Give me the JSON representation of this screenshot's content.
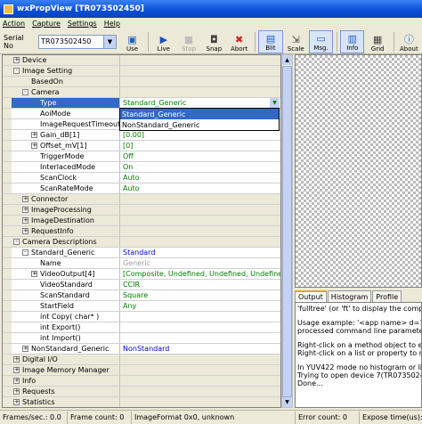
{
  "window": {
    "title": "wxPropView [TR073502450]"
  },
  "menu": [
    "Action",
    "Capture",
    "Settings",
    "Help"
  ],
  "toolbar": {
    "serial_label": "Serial No",
    "serial_value": "TR073502450",
    "buttons": [
      {
        "label": "Use",
        "icon": "use-icon"
      },
      {
        "label": "Live",
        "icon": "play-icon"
      },
      {
        "label": "Stop",
        "icon": "stop-icon",
        "disabled": true
      },
      {
        "label": "Snap",
        "icon": "camera-icon"
      },
      {
        "label": "Abort",
        "icon": "abort-icon"
      },
      {
        "label": "Blit",
        "icon": "blit-icon",
        "selected": true
      },
      {
        "label": "Scale",
        "icon": "scale-icon"
      },
      {
        "label": "Msg.",
        "icon": "message-icon",
        "selected": true
      },
      {
        "label": "Info",
        "icon": "info-icon",
        "selected": true
      },
      {
        "label": "Grid",
        "icon": "grid-icon"
      },
      {
        "label": "About",
        "icon": "about-icon"
      }
    ]
  },
  "properties": [
    {
      "level": 0,
      "exp": "+",
      "name": "Device",
      "value": "",
      "cat": true
    },
    {
      "level": 0,
      "exp": "-",
      "name": "Image Setting",
      "value": "",
      "cat": true
    },
    {
      "level": 1,
      "exp": "",
      "name": "BasedOn",
      "value": "",
      "cat": true
    },
    {
      "level": 1,
      "exp": "-",
      "name": "Camera",
      "value": "",
      "cat": true
    },
    {
      "level": 2,
      "exp": "",
      "name": "Type",
      "value": "Standard_Generic",
      "combo": true,
      "sel": true
    },
    {
      "level": 2,
      "exp": "",
      "name": "AoiMode",
      "value": ""
    },
    {
      "level": 2,
      "exp": "",
      "name": "ImageRequestTimeout_ms",
      "value": ""
    },
    {
      "level": 2,
      "exp": "+",
      "name": "Gain_dB[1]",
      "value": "[0.00]"
    },
    {
      "level": 2,
      "exp": "+",
      "name": "Offset_mV[1]",
      "value": "[0]"
    },
    {
      "level": 2,
      "exp": "",
      "name": "TriggerMode",
      "value": "Off"
    },
    {
      "level": 2,
      "exp": "",
      "name": "InterlacedMode",
      "value": "On"
    },
    {
      "level": 2,
      "exp": "",
      "name": "ScanClock",
      "value": "Auto"
    },
    {
      "level": 2,
      "exp": "",
      "name": "ScanRateMode",
      "value": "Auto"
    },
    {
      "level": 1,
      "exp": "+",
      "name": "Connector",
      "value": "",
      "cat": true
    },
    {
      "level": 1,
      "exp": "+",
      "name": "ImageProcessing",
      "value": "",
      "cat": true
    },
    {
      "level": 1,
      "exp": "+",
      "name": "ImageDestination",
      "value": "",
      "cat": true
    },
    {
      "level": 1,
      "exp": "+",
      "name": "RequestInfo",
      "value": "",
      "cat": true
    },
    {
      "level": 0,
      "exp": "-",
      "name": "Camera Descriptions",
      "value": "",
      "cat": true
    },
    {
      "level": 1,
      "exp": "-",
      "name": "Standard_Generic",
      "value": "Standard",
      "vcolor": "blue"
    },
    {
      "level": 2,
      "exp": "",
      "name": "Name",
      "value": "Generic",
      "vcolor": "gray"
    },
    {
      "level": 2,
      "exp": "+",
      "name": "VideoOutput[4]",
      "value": "[Composite, Undefined, Undefined, Undefined]"
    },
    {
      "level": 2,
      "exp": "",
      "name": "VideoStandard",
      "value": "CCIR"
    },
    {
      "level": 2,
      "exp": "",
      "name": "ScanStandard",
      "value": "Square"
    },
    {
      "level": 2,
      "exp": "",
      "name": "StartField",
      "value": "Any"
    },
    {
      "level": 2,
      "exp": "",
      "name": "int Copy( char* )",
      "value": ""
    },
    {
      "level": 2,
      "exp": "",
      "name": "int Export()",
      "value": ""
    },
    {
      "level": 2,
      "exp": "",
      "name": "int Import()",
      "value": ""
    },
    {
      "level": 1,
      "exp": "+",
      "name": "NonStandard_Generic",
      "value": "NonStandard",
      "vcolor": "blue"
    },
    {
      "level": 0,
      "exp": "+",
      "name": "Digital I/O",
      "value": "",
      "cat": true
    },
    {
      "level": 0,
      "exp": "+",
      "name": "Image Memory Manager",
      "value": "",
      "cat": true
    },
    {
      "level": 0,
      "exp": "+",
      "name": "Info",
      "value": "",
      "cat": true
    },
    {
      "level": 0,
      "exp": "+",
      "name": "Requests",
      "value": "",
      "cat": true
    },
    {
      "level": 0,
      "exp": "+",
      "name": "Statistics",
      "value": "",
      "cat": true
    },
    {
      "level": 0,
      "exp": "+",
      "name": "System Settings",
      "value": "",
      "cat": true
    }
  ],
  "dropdown": {
    "options": [
      "Standard_Generic",
      "NonStandard_Generic"
    ]
  },
  "tabs": [
    "Output",
    "Histogram",
    "Profile"
  ],
  "output": {
    "lines": [
      {
        "t": "'fulltree' (or 'ft' to display the complete prope",
        "gap": false
      },
      {
        "t": "Usage example: '<app name> d=1 h=340'",
        "gap": true
      },
      {
        "t": "processed command line parameters: none",
        "gap": false
      },
      {
        "t": "Right-click on a method object to execute it",
        "gap": true
      },
      {
        "t": "Right-click on a list or property to restore its",
        "gap": false
      },
      {
        "t": "In YUV422 mode no histogram or line profiles",
        "gap": true
      },
      {
        "t": "Trying to open device 7(TR073502450).",
        "gap": false
      },
      {
        "t": "Done...",
        "gap": false
      }
    ]
  },
  "status": {
    "fps": "Frames/sec.: 0.0",
    "frames": "Frame count: 0",
    "format": "ImageFormat 0x0, unknown",
    "errors": "Error count: 0",
    "expose": "Expose time(us): 0"
  }
}
